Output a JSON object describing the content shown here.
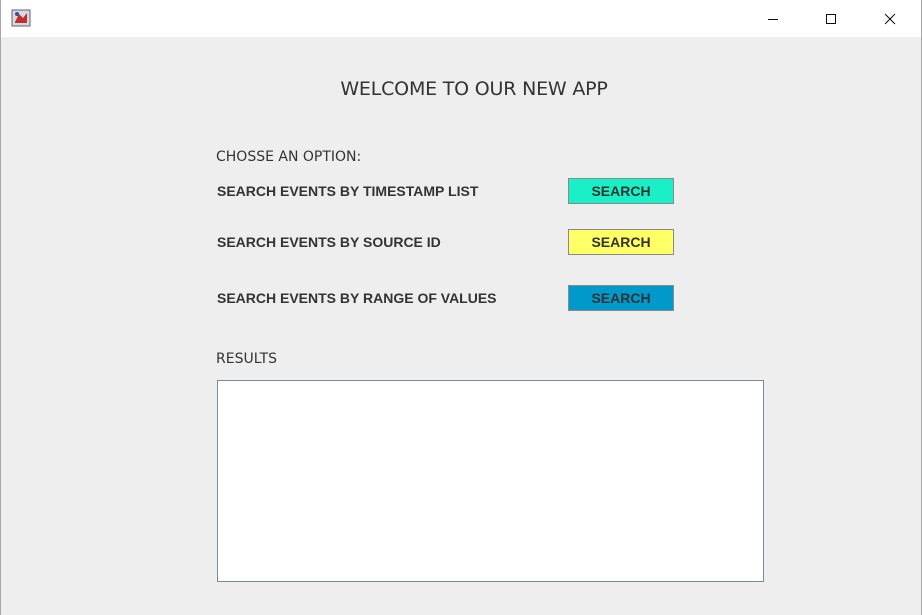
{
  "window": {
    "title": "",
    "icon": "java-app-icon",
    "controls": [
      "minimize-icon",
      "maximize-icon",
      "close-icon"
    ]
  },
  "header": {
    "welcome": "WELCOME TO OUR NEW APP"
  },
  "options": {
    "prompt": "CHOSSE AN OPTION:",
    "items": [
      {
        "label": "SEARCH EVENTS BY TIMESTAMP LIST",
        "button": "SEARCH",
        "color": "#1af0c8"
      },
      {
        "label": "SEARCH EVENTS BY SOURCE ID",
        "button": "SEARCH",
        "color": "#ffff66"
      },
      {
        "label": "SEARCH EVENTS BY RANGE OF VALUES",
        "button": "SEARCH",
        "color": "#0099cc"
      }
    ]
  },
  "results": {
    "label": "RESULTS",
    "value": ""
  }
}
